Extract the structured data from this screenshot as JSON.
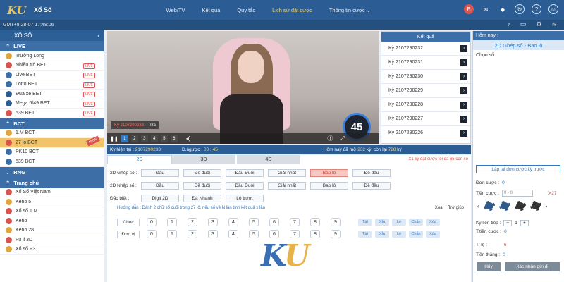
{
  "header": {
    "logo": "KU",
    "title": "Xổ Số",
    "nav": [
      "Web/TV",
      "Kết quả",
      "Quy tắc",
      "Lịch sử đặt cược",
      "Thông tin cược ⌄"
    ],
    "nav_active": "Lịch sử đặt cược",
    "avatar_letter": "B"
  },
  "subbar": {
    "time": "GMT+8 28-07 17:48:06"
  },
  "sidebar": {
    "title": "XỔ SỐ",
    "sections": [
      {
        "label": "LIVE",
        "items": [
          "Trường Long",
          "Nhiều trò BET",
          "Live BET",
          "Lotto BET",
          "Đua xe BET",
          "Mega 6/49 BET",
          "539 BET"
        ]
      },
      {
        "label": "BCT",
        "items": [
          "1.M BCT",
          "27 lo BCT",
          "PK10 BCT",
          "539 BCT"
        ]
      },
      {
        "label": "RNG",
        "items": []
      },
      {
        "label": "Trang chủ",
        "items": [
          "Xổ Số Việt Nam",
          "Keno 5",
          "Xổ số 1.M",
          "Keno",
          "Keno 28",
          "Fu li 3D",
          "Xổ số P3"
        ]
      }
    ],
    "live_badge": "LIVE",
    "new_tag": "NEW",
    "active_item": "27 lo BCT"
  },
  "video": {
    "draw_label": "Kỳ 2107290233",
    "draw_btn": "Tra",
    "tabs": [
      "1",
      "2",
      "3",
      "4",
      "5",
      "6"
    ],
    "countdown": "45"
  },
  "results": {
    "title": "Kết quả",
    "rows": [
      "Kỳ 2107290232",
      "Kỳ 2107290231",
      "Kỳ 2107290230",
      "Kỳ 2107290229",
      "Kỳ 2107290228",
      "Kỳ 2107290227",
      "Kỳ 2107290226"
    ]
  },
  "infobar": {
    "current_label": "Kỳ hiện tại :",
    "current_value": "2107290233",
    "countdown_label": "Đ.ngược :",
    "countdown_value": "00 : 45",
    "today_text": "Hôm nay đã mở",
    "opened": "232",
    "remaining_text": "kỳ, còn lại",
    "remaining": "728",
    "unit": "kỳ"
  },
  "bet": {
    "tabs": [
      "2D",
      "3D",
      "4D"
    ],
    "promo": "X1 kỳ đặt cược tối đa 65 con số",
    "row1_label": "2D Ghép số :",
    "row2_label": "2D Nhập số :",
    "row3_label": "Đặc biệt :",
    "options": [
      "Đầu",
      "Đề đuôi",
      "Đầu Đuôi",
      "Giải nhất",
      "Bao lô",
      "Đề đầu"
    ],
    "selected": "Bao lô",
    "special": [
      "Digit 2D",
      "Đá Nhanh",
      "Lô trượt"
    ],
    "guide": "Hướng dẫn : Đánh 2 chữ số cuối trong 27 lô, nếu số về N lần tính kết quả x lần",
    "xoa": "Xóa",
    "trogiup": "Trợ giúp",
    "chuc": "Chục",
    "donvi": "Đơn vị",
    "numbers": [
      "0",
      "1",
      "2",
      "3",
      "4",
      "5",
      "6",
      "7",
      "8",
      "9"
    ],
    "quick": [
      "Tài",
      "Xỉu",
      "Lẻ",
      "Chẵn",
      "Xóa"
    ]
  },
  "right": {
    "today": "Hôm nay :",
    "mode": "2D Ghép số - Bao lô",
    "choose": "Chọn số",
    "repeat_btn": "Lập lại đơn cược kỳ trước",
    "don_cuoc": "Đơn cược :",
    "don_cuoc_val": "0",
    "tien_cuoc": "Tiền cược :",
    "tien_placeholder": "0 - 0",
    "multiplier": "X27",
    "ky_lien_tiep": "Kỳ liên tiếp :",
    "ky_val": "1",
    "t_tien_cuoc": "T.tiền cược :",
    "t_tien_val": "0",
    "ti_le": "Tỉ lệ :",
    "ti_le_val": "6",
    "tien_thang": "Tiền thắng :",
    "tien_thang_val": "0",
    "cancel": "Hủy",
    "confirm": "Xác nhận gửi đi"
  }
}
